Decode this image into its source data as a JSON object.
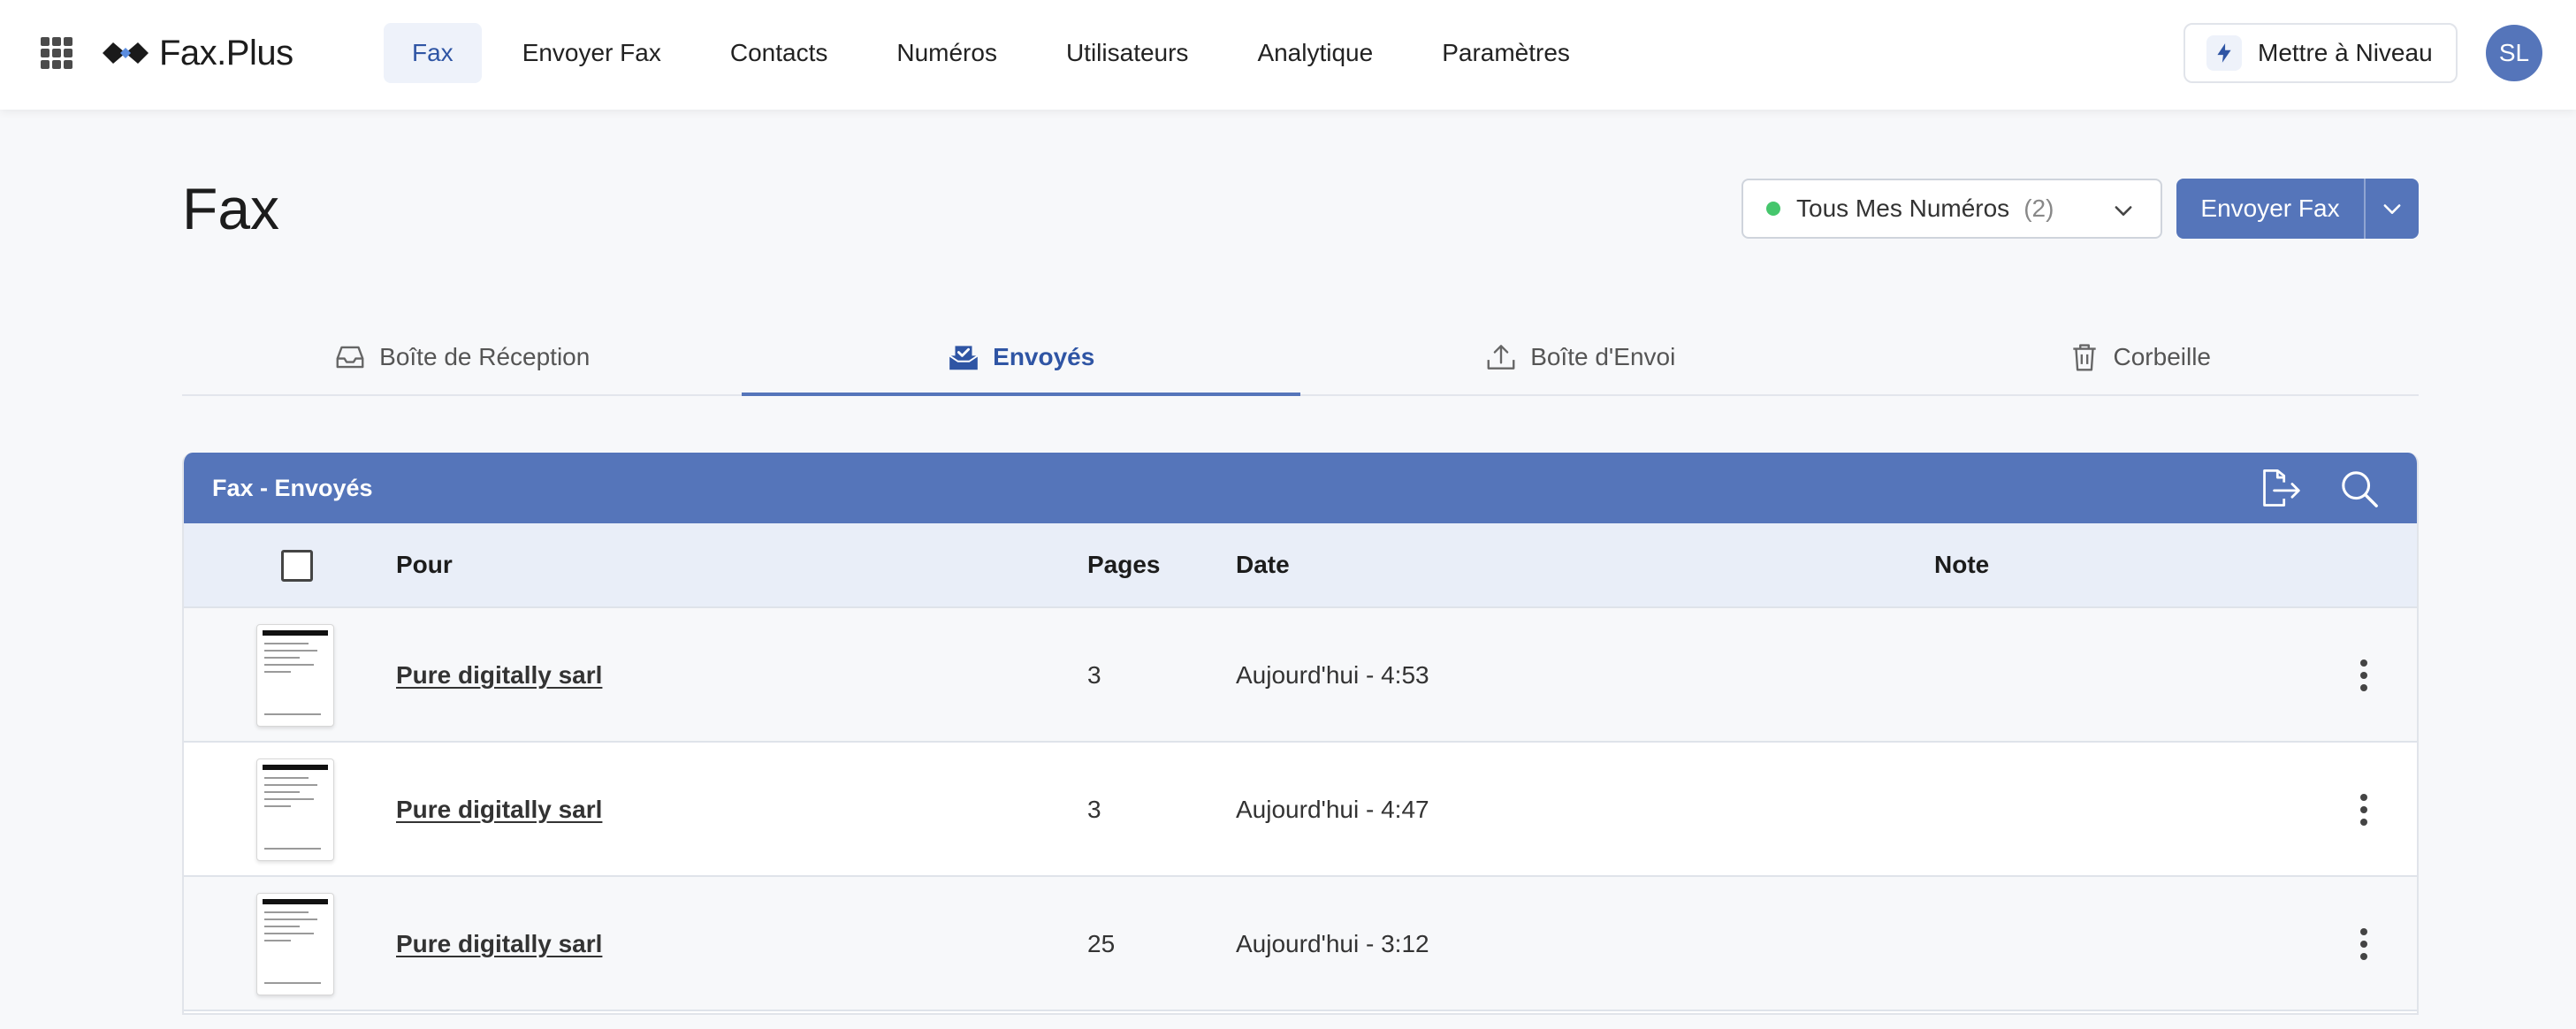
{
  "app": {
    "brand": "Fax.Plus"
  },
  "nav": {
    "items": [
      {
        "label": "Fax",
        "active": true
      },
      {
        "label": "Envoyer Fax"
      },
      {
        "label": "Contacts"
      },
      {
        "label": "Numéros"
      },
      {
        "label": "Utilisateurs"
      },
      {
        "label": "Analytique"
      },
      {
        "label": "Paramètres"
      }
    ],
    "upgrade_label": "Mettre à Niveau",
    "upgrade_icon": "lightning-icon",
    "avatar_initials": "SL"
  },
  "page": {
    "title": "Fax",
    "number_select": {
      "label": "Tous Mes Numéros",
      "count": "(2)",
      "status_color": "#45c66c"
    },
    "send_button": "Envoyer Fax"
  },
  "tabs": [
    {
      "label": "Boîte de Réception",
      "icon": "inbox-icon"
    },
    {
      "label": "Envoyés",
      "icon": "sent-icon",
      "active": true
    },
    {
      "label": "Boîte d'Envoi",
      "icon": "outbox-icon"
    },
    {
      "label": "Corbeille",
      "icon": "trash-icon"
    }
  ],
  "table": {
    "title": "Fax - Envoyés",
    "columns": {
      "to": "Pour",
      "pages": "Pages",
      "date": "Date",
      "note": "Note"
    },
    "rows": [
      {
        "to": "Pure digitally sarl",
        "pages": "3",
        "date": "Aujourd'hui - 4:53",
        "note": ""
      },
      {
        "to": "Pure digitally sarl",
        "pages": "3",
        "date": "Aujourd'hui - 4:47",
        "note": ""
      },
      {
        "to": "Pure digitally sarl",
        "pages": "25",
        "date": "Aujourd'hui - 3:12",
        "note": ""
      }
    ]
  },
  "colors": {
    "accent": "#5575ba",
    "accent_dark": "#2f55a4",
    "header_row": "#e9eef8"
  }
}
